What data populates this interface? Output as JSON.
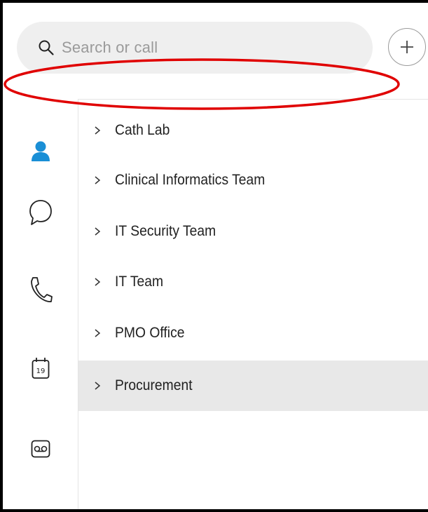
{
  "search": {
    "placeholder": "Search or call",
    "icon": "search-icon"
  },
  "add_button": {
    "icon": "plus-icon",
    "label": "+"
  },
  "nav_rail": {
    "items": [
      {
        "name": "contacts",
        "icon": "person-icon",
        "active": true,
        "color": "#1a8fd6"
      },
      {
        "name": "messaging",
        "icon": "chat-bubble-icon",
        "active": false
      },
      {
        "name": "calls",
        "icon": "phone-icon",
        "active": false
      },
      {
        "name": "meetings",
        "icon": "calendar-icon",
        "active": false,
        "badge": "19"
      },
      {
        "name": "voicemail",
        "icon": "voicemail-icon",
        "active": false
      }
    ]
  },
  "groups": [
    {
      "label": "Cath Lab",
      "icon": "chevron-right-icon",
      "selected": false
    },
    {
      "label": "Clinical Informatics Team",
      "icon": "chevron-right-icon",
      "selected": false
    },
    {
      "label": "IT Security Team",
      "icon": "chevron-right-icon",
      "selected": false
    },
    {
      "label": "IT Team",
      "icon": "chevron-right-icon",
      "selected": false
    },
    {
      "label": "PMO Office",
      "icon": "chevron-right-icon",
      "selected": false
    },
    {
      "label": "Procurement",
      "icon": "chevron-right-icon",
      "selected": true
    }
  ],
  "colors": {
    "accent": "#1a8fd6",
    "annotation": "#e00000",
    "selected_row": "#e8e8e8",
    "search_bg": "#efefef"
  }
}
